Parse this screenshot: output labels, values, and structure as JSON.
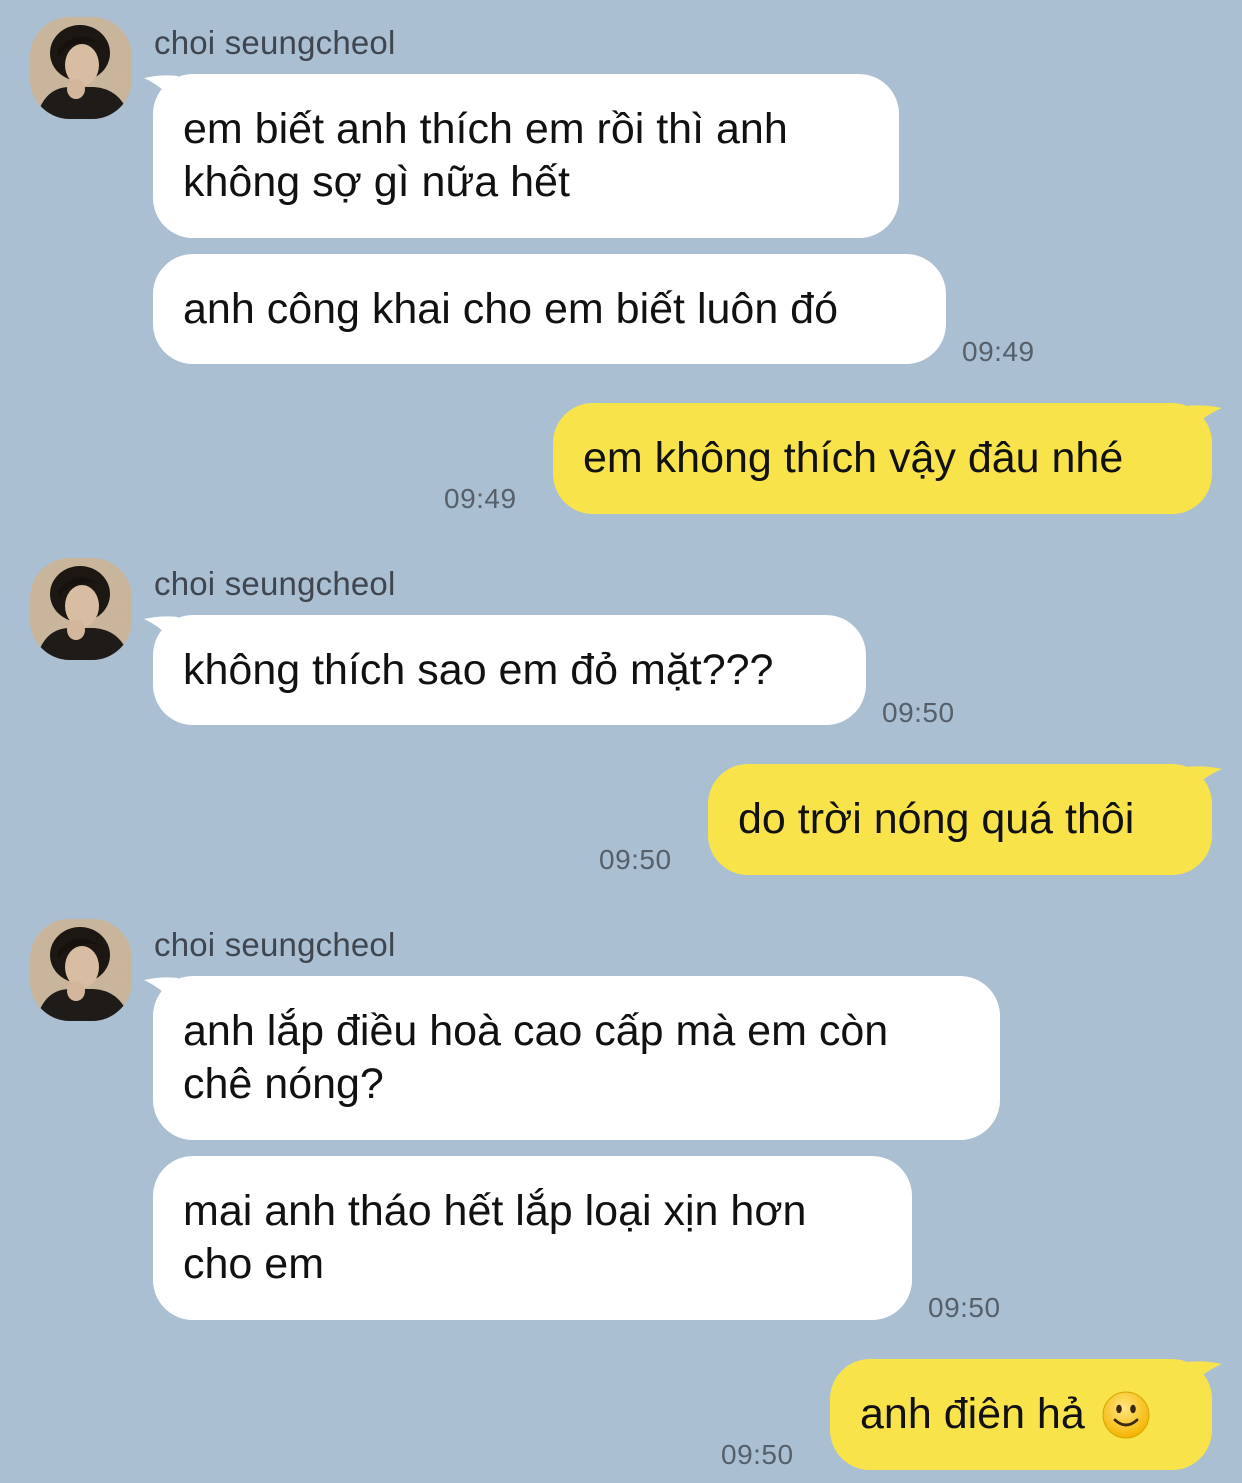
{
  "theme": {
    "background": "#abbfd2",
    "incoming_bubble": "#ffffff",
    "outgoing_bubble": "#f8e44a"
  },
  "contact": {
    "name": "choi seungcheol",
    "avatar_icon": "profile-photo"
  },
  "groups": [
    {
      "sender": "choi seungcheol",
      "messages": [
        "em biết anh thích em rồi thì anh\nkhông sợ gì nữa hết",
        "anh công khai cho em biết luôn đó"
      ],
      "time": "09:49"
    },
    {
      "outgoing": "em không thích vậy đâu nhé",
      "time": "09:49"
    },
    {
      "sender": "choi seungcheol",
      "messages": [
        "không thích sao em đỏ mặt???"
      ],
      "time": "09:50"
    },
    {
      "outgoing": "do trời nóng quá thôi",
      "time": "09:50"
    },
    {
      "sender": "choi seungcheol",
      "messages": [
        "anh lắp điều hoà cao cấp mà em còn\nchê nóng?",
        "mai anh tháo hết lắp loại xịn hơn\ncho em"
      ],
      "time": "09:50"
    },
    {
      "outgoing": "anh điên hả",
      "emoji": "slightly-smiling-face",
      "time": "09:50"
    }
  ]
}
